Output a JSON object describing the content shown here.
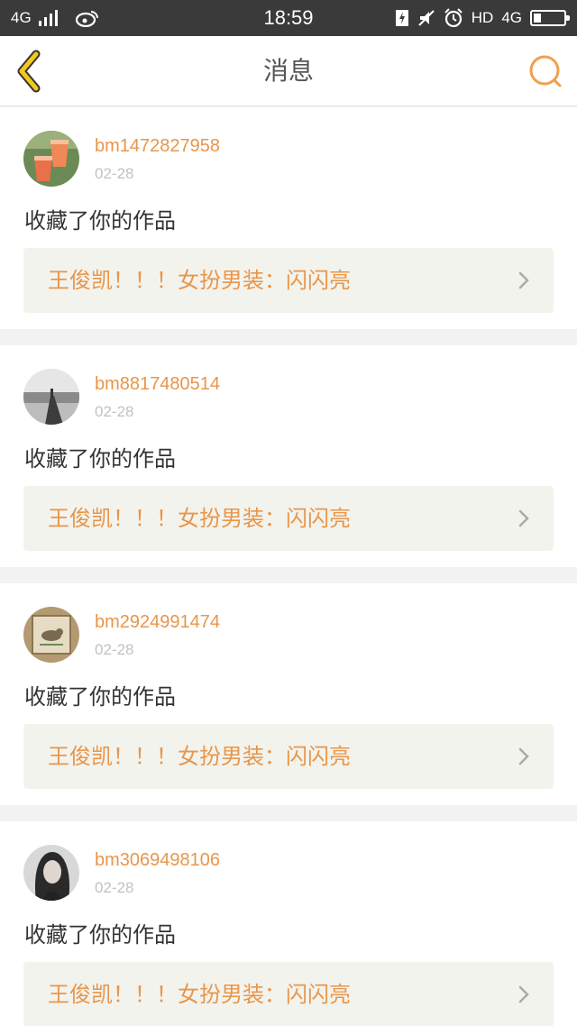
{
  "status_bar": {
    "network": "4G",
    "time": "18:59",
    "hd_label": "HD",
    "network_right": "4G"
  },
  "header": {
    "title": "消息"
  },
  "messages": [
    {
      "username": "bm1472827958",
      "date": "02-28",
      "action": "收藏了你的作品",
      "work_title": "王俊凯！！！女扮男装：闪闪亮"
    },
    {
      "username": "bm8817480514",
      "date": "02-28",
      "action": "收藏了你的作品",
      "work_title": "王俊凯！！！女扮男装：闪闪亮"
    },
    {
      "username": "bm2924991474",
      "date": "02-28",
      "action": "收藏了你的作品",
      "work_title": "王俊凯！！！女扮男装：闪闪亮"
    },
    {
      "username": "bm3069498106",
      "date": "02-28",
      "action": "收藏了你的作品",
      "work_title": "王俊凯！！！女扮男装：闪闪亮"
    }
  ],
  "colors": {
    "accent": "#e8964a",
    "back_icon": "#f2c81c",
    "search_icon": "#f0a050"
  }
}
